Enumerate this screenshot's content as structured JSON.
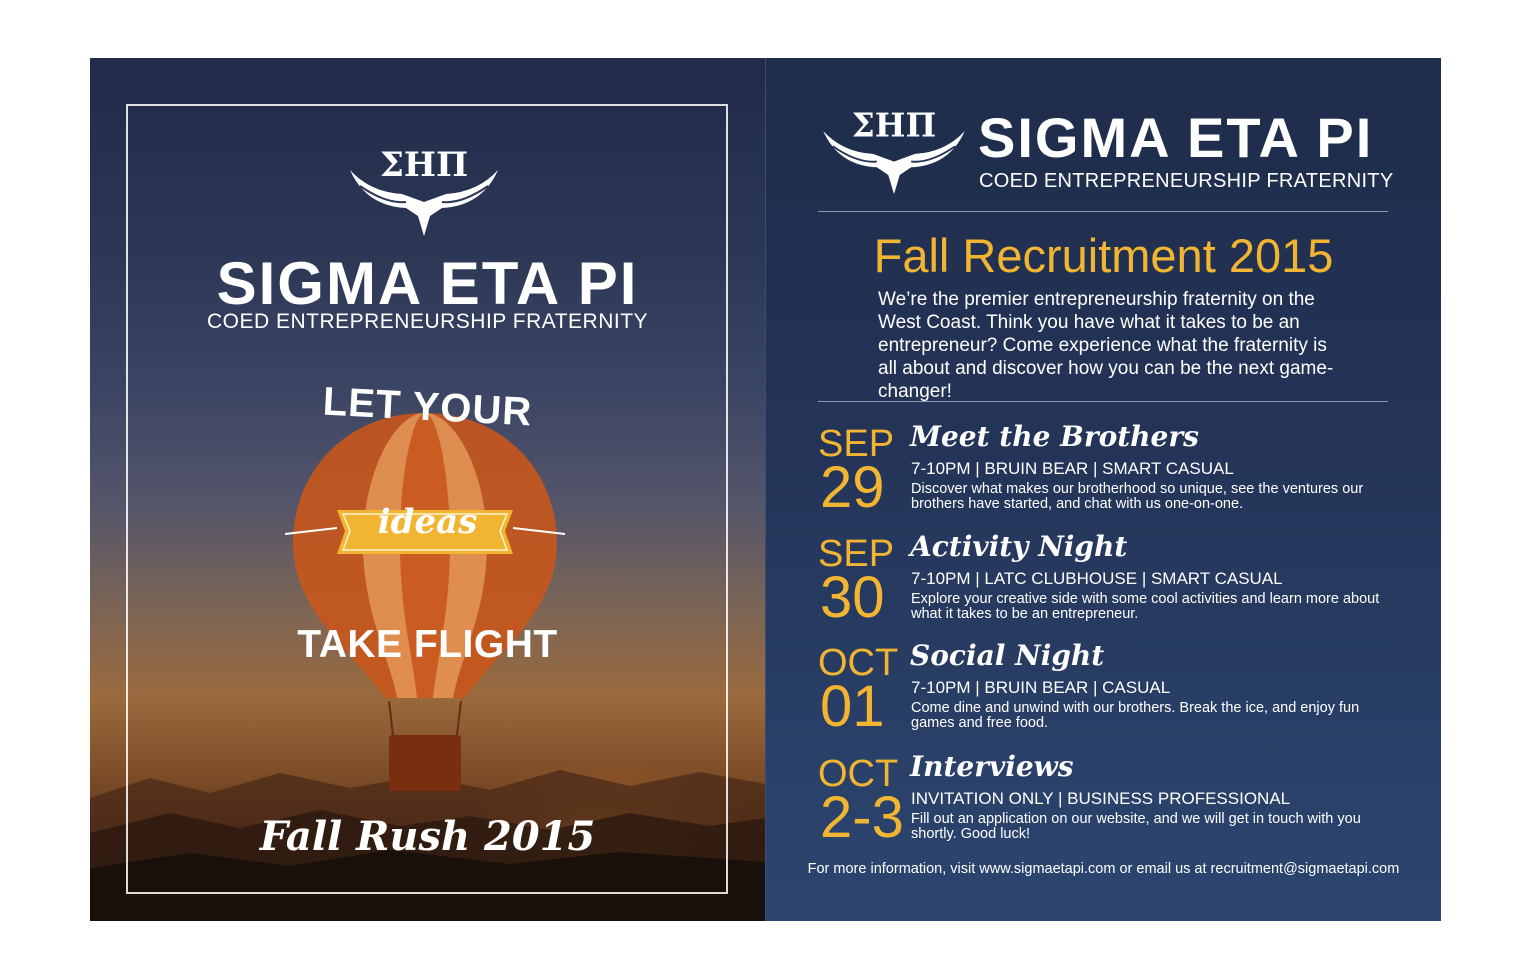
{
  "brand": {
    "name": "SIGMA ETA PI",
    "tagline": "COED ENTREPRENEURSHIP FRATERNITY",
    "letters": "ΣΗΠ"
  },
  "left_panel": {
    "headline_top": "LET YOUR",
    "headline_ribbon": "ideas",
    "headline_bottom": "TAKE FLIGHT",
    "event_title": "Fall Rush 2015"
  },
  "right_panel": {
    "heading": "Fall Recruitment 2015",
    "intro": "We’re the premier entrepreneurship fraternity on the West Coast. Think you have what it takes to be an entrepreneur? Come experience what the fraternity is all about and discover how you can be the next game-changer!",
    "events": [
      {
        "month": "SEP",
        "day": "29",
        "name": "Meet the Brothers",
        "details": "7-10PM | BRUIN BEAR | SMART CASUAL",
        "description": "Discover what makes our brotherhood so unique, see the ventures our brothers have started, and chat with us one-on-one."
      },
      {
        "month": "SEP",
        "day": "30",
        "name": "Activity Night",
        "details": "7-10PM | LATC CLUBHOUSE | SMART CASUAL",
        "description": "Explore your creative side with some cool activities and learn more about what it takes to be an entrepreneur."
      },
      {
        "month": "OCT",
        "day": "01",
        "name": "Social Night",
        "details": "7-10PM | BRUIN BEAR | CASUAL",
        "description": "Come dine and unwind with our brothers. Break the ice, and enjoy fun games and free food."
      },
      {
        "month": "OCT",
        "day": "2-3",
        "name": "Interviews",
        "details": "INVITATION ONLY | BUSINESS PROFESSIONAL",
        "description": "Fill out an application on our website, and we will get in touch with you shortly. Good luck!"
      }
    ],
    "footer": "For more information, visit www.sigmaetapi.com or email us at recruitment@sigmaetapi.com"
  },
  "colors": {
    "accent_gold": "#f2b531",
    "navy": "#243458",
    "balloon_orange": "#c8571c",
    "balloon_stripe": "#e8a060"
  },
  "icons": [
    "eagle-logo-icon",
    "hot-air-balloon-icon",
    "ribbon-banner-icon"
  ]
}
